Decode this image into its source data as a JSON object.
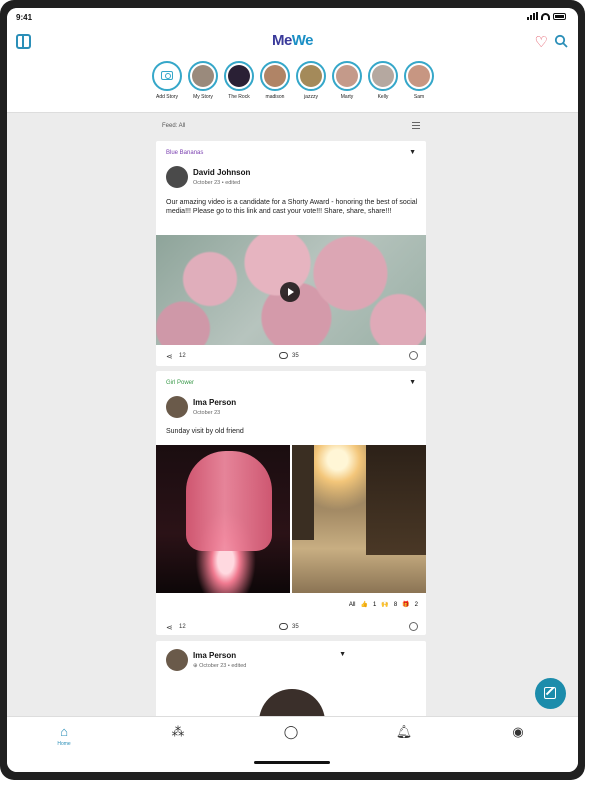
{
  "status_bar": {
    "time": "9:41"
  },
  "header": {
    "logo_part1": "Me",
    "logo_part2": "We"
  },
  "stories": [
    {
      "label": "Add Story",
      "color": ""
    },
    {
      "label": "My Story",
      "color": "#9a8a7c"
    },
    {
      "label": "The Rock",
      "color": "#2a2035"
    },
    {
      "label": "madison",
      "color": "#b08466"
    },
    {
      "label": "jazzzy",
      "color": "#a48a5a"
    },
    {
      "label": "Marty",
      "color": "#c49a8a"
    },
    {
      "label": "Kelly",
      "color": "#b5a8a0"
    },
    {
      "label": "Sam",
      "color": "#c79682"
    }
  ],
  "feed": {
    "label": "Feed: All"
  },
  "posts": [
    {
      "group": "Blue Bananas",
      "group_color": "#7a3fb0",
      "author": "David Johnson",
      "meta": "October 23 • edited",
      "text": "Our amazing video is a candidate for a Shorty Award - honoring the best of social media!!! Please go to this link and cast your vote!!! Share, share, share!!!",
      "share_count": "12",
      "comment_count": "35"
    },
    {
      "group": "Girl Power",
      "group_color": "#3a9a4a",
      "author": "Ima Person",
      "meta": "October 23",
      "text": "Sunday visit by old friend",
      "reactions": {
        "all_label": "All",
        "r1": "1",
        "r2": "8",
        "r3": "2"
      },
      "share_count": "12",
      "comment_count": "35"
    },
    {
      "author": "Ima Person",
      "meta": "October 23 • edited"
    }
  ],
  "tabs": [
    {
      "label": "Home",
      "icon": "home-icon"
    },
    {
      "label": "",
      "icon": "groups-icon"
    },
    {
      "label": "",
      "icon": "chat-icon"
    },
    {
      "label": "",
      "icon": "bell-icon"
    },
    {
      "label": "",
      "icon": "profile-icon"
    }
  ]
}
